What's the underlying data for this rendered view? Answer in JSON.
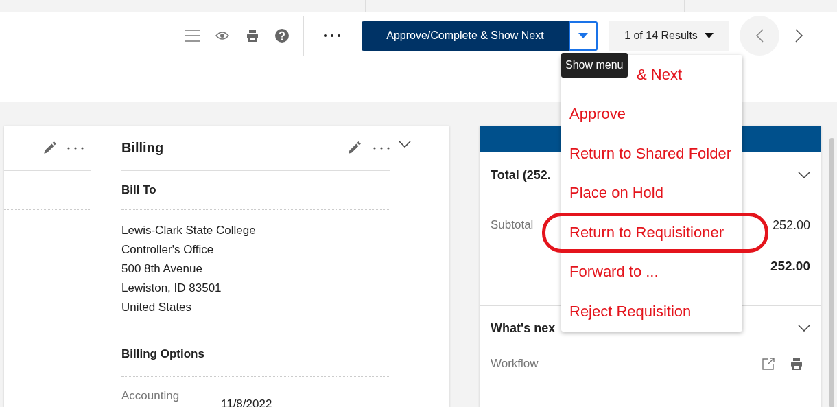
{
  "toolbar": {
    "primary_button": "Approve/Complete & Show Next",
    "results": "1 of 14 Results"
  },
  "tooltip": "Show menu",
  "menu": {
    "items": [
      {
        "label": "& Next",
        "kind": "covered",
        "circled": false
      },
      {
        "label": "Approve",
        "kind": "plain",
        "circled": false
      },
      {
        "label": "Return to Shared Folder",
        "kind": "plain",
        "circled": false
      },
      {
        "label": "Place on Hold",
        "kind": "plain",
        "circled": false
      },
      {
        "label": "Return to Requisitioner",
        "kind": "plain",
        "circled": true
      },
      {
        "label": "Forward to ...",
        "kind": "plain",
        "circled": false
      },
      {
        "label": "Reject Requisition",
        "kind": "plain",
        "circled": false
      }
    ]
  },
  "billing": {
    "title": "Billing",
    "bill_to": {
      "heading": "Bill To",
      "lines": [
        "Lewis-Clark State College",
        "Controller's Office",
        "500 8th Avenue",
        "Lewiston, ID 83501",
        "United States"
      ]
    },
    "billing_options": {
      "heading": "Billing Options",
      "label": "Accounting",
      "value": "11/8/2022"
    }
  },
  "summary": {
    "total_heading": "Total (252.",
    "subtotal_label": "Subtotal",
    "subtotal": "252.00",
    "total": "252.00",
    "whats_next": "What's nex",
    "workflow": "Workflow"
  }
}
